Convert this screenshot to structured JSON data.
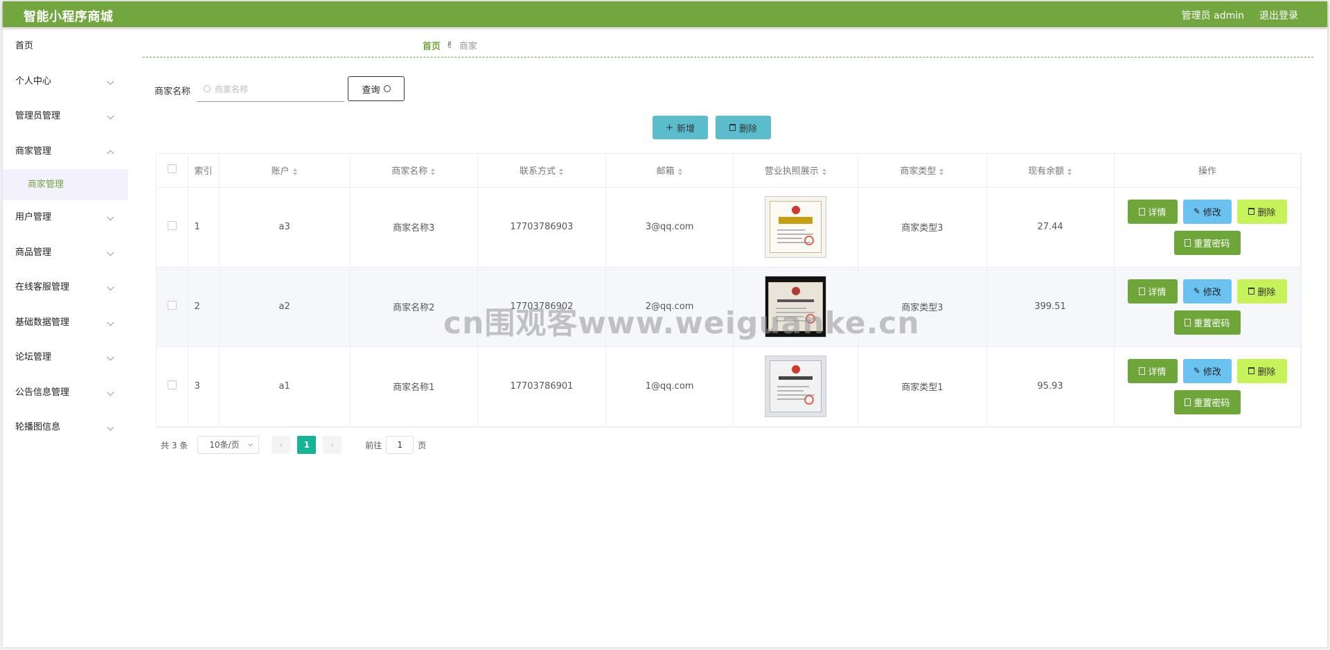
{
  "header": {
    "title": "智能小程序商城",
    "admin_label": "管理员 admin",
    "logout_label": "退出登录"
  },
  "sidebar": {
    "items": [
      {
        "label": "首页"
      },
      {
        "label": "个人中心"
      },
      {
        "label": "管理员管理"
      },
      {
        "label": "商家管理",
        "expanded": true,
        "sub": [
          {
            "label": "商家管理",
            "active": true
          }
        ]
      },
      {
        "label": "用户管理"
      },
      {
        "label": "商品管理"
      },
      {
        "label": "在线客服管理"
      },
      {
        "label": "基础数据管理"
      },
      {
        "label": "论坛管理"
      },
      {
        "label": "公告信息管理"
      },
      {
        "label": "轮播图信息"
      }
    ]
  },
  "breadcrumb": {
    "home": "首页",
    "current": "商家"
  },
  "search": {
    "label": "商家名称",
    "placeholder": "商家名称",
    "value": "",
    "query_label": "查询"
  },
  "toolbar": {
    "add_label": "新增",
    "delete_label": "删除"
  },
  "table": {
    "headers": [
      "索引",
      "账户",
      "商家名称",
      "联系方式",
      "邮箱",
      "营业执照展示",
      "商家类型",
      "现有余额",
      "操作"
    ],
    "rows": [
      {
        "index": "1",
        "account": "a3",
        "name": "商家名称3",
        "phone": "17703786903",
        "email": "3@qq.com",
        "type": "商家类型3",
        "balance": "27.44"
      },
      {
        "index": "2",
        "account": "a2",
        "name": "商家名称2",
        "phone": "17703786902",
        "email": "2@qq.com",
        "type": "商家类型3",
        "balance": "399.51"
      },
      {
        "index": "3",
        "account": "a1",
        "name": "商家名称1",
        "phone": "17703786901",
        "email": "1@qq.com",
        "type": "商家类型1",
        "balance": "95.93"
      }
    ],
    "actions": {
      "detail": "详情",
      "edit": "修改",
      "remove": "删除",
      "reset": "重置密码"
    }
  },
  "pagination": {
    "total_label": "共 3 条",
    "page_size": "10条/页",
    "current_page": "1",
    "goto_label": "前往",
    "goto_value": "1",
    "page_suffix": "页"
  },
  "watermark": "cn围观客www.weiguanke.cn",
  "colors": {
    "primary": "#72a63f",
    "accent": "#5bbdcc",
    "page_active": "#13b596"
  }
}
